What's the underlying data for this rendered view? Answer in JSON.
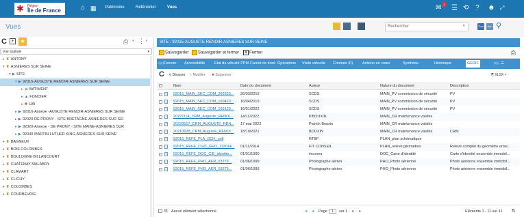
{
  "brand": {
    "line1": "Région",
    "line2": "Île de France"
  },
  "topnav": {
    "patrimoine": "Patrimoine",
    "referentiel": "Référentiel",
    "vues": "Vues"
  },
  "notifications_count": "1",
  "page_title": "Vues",
  "search": {
    "placeholder": "Rechercher"
  },
  "search_buttons": {
    "field": "Tout",
    "scope": "Ann"
  },
  "left": {
    "view_select": "Vue spatiale",
    "tree": [
      {
        "label": "ANTONY",
        "indent": 1,
        "icon": "city",
        "expanded": false
      },
      {
        "label": "ASNIERES SUR SEINE",
        "indent": 1,
        "icon": "city",
        "expanded": true
      },
      {
        "label": "SITE",
        "indent": 2,
        "icon": "site",
        "expanded": true
      },
      {
        "label": "92016-AUGUSTE RENOIR-ASNIERES SUR SEINE",
        "indent": 3,
        "icon": "site",
        "expanded": true,
        "selected": true
      },
      {
        "label": "BATIMENT",
        "indent": 4,
        "icon": "building",
        "expanded": false
      },
      {
        "label": "FONCIER",
        "indent": 4,
        "icon": "foncier",
        "expanded": false
      },
      {
        "label": "UAI",
        "indent": 4,
        "icon": "uai",
        "expanded": false
      },
      {
        "label": "92016-Annexe -AUGUSTE RENOIR-ASNIERES SUR SEINE",
        "indent": 3,
        "icon": "site",
        "expanded": false
      },
      {
        "label": "92020-DE PRONY - SITE BRETAGNE-ASNIERES SUR SEI",
        "indent": 3,
        "icon": "site",
        "expanded": false
      },
      {
        "label": "92020-Annexe - DE PRONY - SITE MAINE-ASNIERES SUR",
        "indent": 3,
        "icon": "site",
        "expanded": false
      },
      {
        "label": "92040-MARTIN LUTHER KING-ASNIERES SUR SEINE",
        "indent": 3,
        "icon": "site",
        "expanded": false
      },
      {
        "label": "BAGNEUX",
        "indent": 1,
        "icon": "city",
        "expanded": false
      },
      {
        "label": "BOIS COLOMBES",
        "indent": 1,
        "icon": "city",
        "expanded": false
      },
      {
        "label": "BOULOGNE BILLANCOURT",
        "indent": 1,
        "icon": "city",
        "expanded": false
      },
      {
        "label": "CHATENAY MALABRY",
        "indent": 1,
        "icon": "city",
        "expanded": false
      },
      {
        "label": "CLAMART",
        "indent": 1,
        "icon": "city",
        "expanded": false
      },
      {
        "label": "CLICHY",
        "indent": 1,
        "icon": "city",
        "expanded": false
      },
      {
        "label": "COLOMBES",
        "indent": 1,
        "icon": "city",
        "expanded": false
      },
      {
        "label": "COURBEVOIE",
        "indent": 1,
        "icon": "city",
        "expanded": false
      }
    ]
  },
  "site_title": "SITE : 92015-AUGUSTE RENOIR-ASNIERES SUR SEINE",
  "actions": {
    "save": "Sauvegarder",
    "save_close": "Sauvegarder et fermer",
    "close": "Fermer"
  },
  "tabs": [
    "Foncier",
    "Accessibilité",
    "Etat de vétusté PPM",
    "Carnet de bord",
    "Opérations",
    "Visite virtuelle",
    "Contrats (0)",
    "Actions en cours",
    "Synthèse",
    "Historique",
    "GEDIF"
  ],
  "doc_tools": {
    "deposer": "Déposer",
    "modifier": "Modifier",
    "supprimer": "Supprimer",
    "export": "XLSX"
  },
  "table": {
    "columns": [
      "Nom",
      "Date du document",
      "Auteur",
      "Nature du document",
      "Description"
    ],
    "rows": [
      [
        "92015_MAIN_SEC_COM_260320...",
        "26/03/2019",
        "SCDS",
        "MAIN_PV commission de sécurité",
        "PV"
      ],
      [
        "92015_MAIN_SEC_COM_160420...",
        "16/04/2019",
        "SCDS",
        "MAIN_PV commission de sécurité",
        "PV"
      ],
      [
        "92015_MAIN_SEC_COM_160120...",
        "16/01/2022",
        "SCDS",
        "MAIN_PV commission de sécurité",
        "PV"
      ],
      [
        "20221114_CRM_Auguste_RENOI...",
        "14/11/2022",
        "P.BOUXIN",
        "MAIN_CR maintenance validés",
        ""
      ],
      [
        "20220517_CRM_AUGUSTE_REN...",
        "17 mai 2022",
        "Patrick Bouxin",
        "MAIN_CR maintenance validés",
        ""
      ],
      [
        "20210628_CRM_Auguste_RENOI...",
        "18/10/2021",
        "BOUXIN",
        "MAIN_CR maintenance validés",
        "CRM"
      ],
      [
        "92015_REFE_PLA_SCH_.pdf",
        "",
        "RTBF",
        "PLAN_plan schématique",
        ""
      ],
      [
        "92015_REFE_CGO_GEO_112014...",
        "01/11/2014",
        "FIT CONSEIL",
        "PLAN_relevé géomètres",
        "Relevé complet du géomètre ense..."
      ],
      [
        "92015_REFE_DOC_CIE_identite...",
        "01/01/1900",
        "inconnu",
        "DOC_Carte d'identité",
        "Carte d'identité ensemble immobil..."
      ],
      [
        "92015_REFE_PHO_AER_03279...",
        "01/06/1999",
        "Photographe aérien",
        "PHO_Photo aérienne",
        "Photo aérienne ensemble immobil..."
      ],
      [
        "92015_REFE_PHO_AER_03279...",
        "01/06/1999",
        "Photographe aérien",
        "PHO_Photo aérienne",
        "Photo aérienne ensemble immobil..."
      ]
    ]
  },
  "footer": {
    "selection": "Aucun élément sélectionné",
    "page_label": "Page",
    "page_value": "1",
    "page_total": "sur 1",
    "range": "Eléments 1 - 11 sur 11"
  },
  "colors": {
    "topbar": "#1c76b2",
    "tabbar": "#3f92cd",
    "link": "#1c76b2",
    "selected_row": "#b9d9ef"
  }
}
